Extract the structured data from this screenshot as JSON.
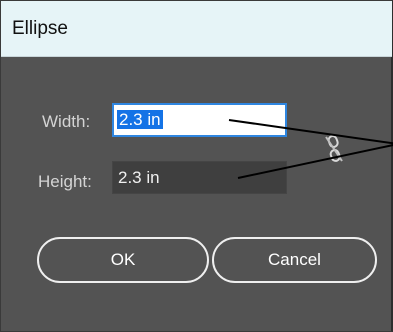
{
  "dialog": {
    "title": "Ellipse",
    "width_label": "Width:",
    "width_value": "2.3 in",
    "height_label": "Height:",
    "height_value": "2.3 in",
    "constrain_icon": "chain-link-broken-icon",
    "ok_label": "OK",
    "cancel_label": "Cancel"
  },
  "colors": {
    "dialog_bg": "#535353",
    "titlebar_bg": "#e6f4f7",
    "focus_border": "#2f86e0",
    "selection": "#1473e6",
    "annotation_line": "#000000"
  }
}
